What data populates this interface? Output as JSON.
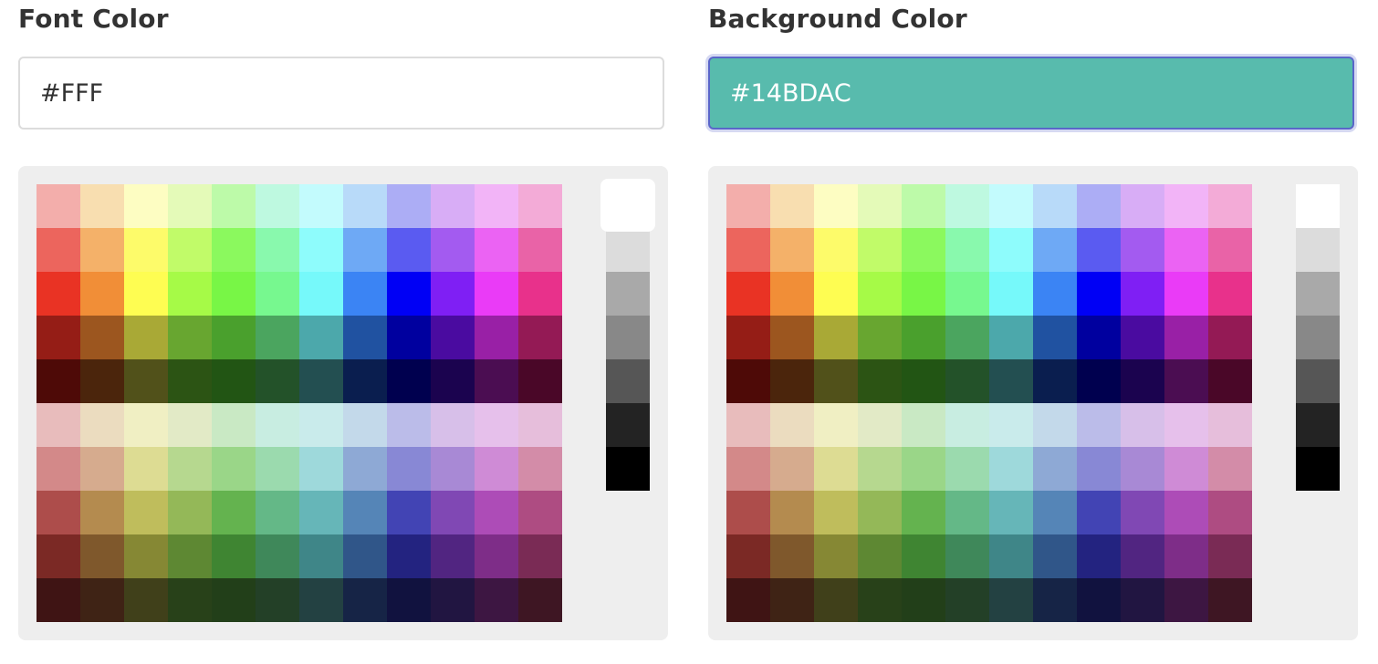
{
  "font_color": {
    "label": "Font Color",
    "value": "#FFF",
    "input_background": "#ffffff",
    "selected_gray_index": 0
  },
  "background_color": {
    "label": "Background Color",
    "value": "#14BDAC",
    "input_background": "#58bbad"
  },
  "palette": [
    [
      "#f3aeab",
      "#f8deb0",
      "#fdfdc2",
      "#e4fab8",
      "#bdfaa9",
      "#bef9e0",
      "#c3fbfd",
      "#b8daf9",
      "#acadf5",
      "#d8adf6",
      "#f2b4f7",
      "#f3abd7"
    ],
    [
      "#ec655d",
      "#f4b169",
      "#fdfb6a",
      "#c1fb69",
      "#8bf95e",
      "#89f9ad",
      "#8efcfc",
      "#6ea9f5",
      "#5a5bf1",
      "#a35bf0",
      "#eb63f3",
      "#e963a7"
    ],
    [
      "#e93324",
      "#f18e37",
      "#fefd52",
      "#a6fa47",
      "#78f646",
      "#77f88f",
      "#76f9fa",
      "#3b84f4",
      "#0000f5",
      "#7f1ff4",
      "#ea3bf7",
      "#e8318b"
    ],
    [
      "#951d16",
      "#9c561f",
      "#a9a936",
      "#68a630",
      "#4aa02d",
      "#4ba55f",
      "#4ca8ab",
      "#2052a1",
      "#00009f",
      "#4a0ba0",
      "#9920a6",
      "#941a55"
    ],
    [
      "#4e0a07",
      "#4b250c",
      "#51511a",
      "#2c5414",
      "#225514",
      "#235229",
      "#234f51",
      "#0a1e4f",
      "#00004f",
      "#1b034f",
      "#4b0d52",
      "#4a0728"
    ],
    [
      "#e8bcbc",
      "#ebdcbf",
      "#f0efc3",
      "#e2eac6",
      "#c9e9c4",
      "#c8ede1",
      "#c9ebeb",
      "#c3d9ea",
      "#bbbce9",
      "#d7bfe9",
      "#e6c0eb",
      "#e6bedb"
    ],
    [
      "#d38989",
      "#d6ab8e",
      "#dddc93",
      "#b6d88f",
      "#9ad688",
      "#9bdaae",
      "#9ed9db",
      "#8ea9d5",
      "#8888d5",
      "#a889d5",
      "#cf8bd6",
      "#d38ca8"
    ],
    [
      "#ad4d4b",
      "#b48b4f",
      "#bfbd5c",
      "#94b858",
      "#64b34f",
      "#64b887",
      "#66b6b8",
      "#5585b7",
      "#4244b4",
      "#8048b4",
      "#ad4cb7",
      "#ae4c82"
    ],
    [
      "#7b2925",
      "#7f582c",
      "#868834",
      "#5e8833",
      "#3f8532",
      "#3f885a",
      "#3f8688",
      "#305689",
      "#232380",
      "#512581",
      "#7e2d88",
      "#7a2b55"
    ],
    [
      "#3f1414",
      "#3f2315",
      "#40401a",
      "#284119",
      "#223f19",
      "#234027",
      "#234142",
      "#162446",
      "#11123f",
      "#211541",
      "#3d1642",
      "#3e1623"
    ]
  ],
  "grays": [
    "#ffffff",
    "#dcdcdc",
    "#a9a9a9",
    "#888888",
    "#565656",
    "#232323",
    "#000000"
  ]
}
